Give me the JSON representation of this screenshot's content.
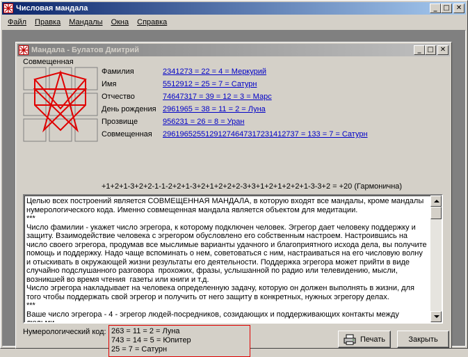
{
  "app": {
    "title": "Числовая мандала"
  },
  "menu": [
    {
      "label": "Файл"
    },
    {
      "label": "Правка"
    },
    {
      "label": "Мандалы"
    },
    {
      "label": "Окна"
    },
    {
      "label": "Справка"
    }
  ],
  "window": {
    "title": "Мандала - Булатов Дмитрий",
    "combined_heading": "Совмещенная"
  },
  "info_rows": [
    {
      "label": "Фамилия",
      "value": "2341273 = 22 = 4 = Меркурий"
    },
    {
      "label": "Имя",
      "value": "5512912 = 25 = 7 = Сатурн"
    },
    {
      "label": "Отчество",
      "value": "74647317 = 39 = 12 = 3 = Марс"
    },
    {
      "label": "День рождения",
      "value": "2961965 = 38 = 11 = 2 = Луна"
    },
    {
      "label": "Прозвище",
      "value": "956231 = 26 = 8 = Уран"
    },
    {
      "label": "Совмещенная",
      "value": "29619652551291274647317231412737 = 133 = 7 = Сатурн"
    }
  ],
  "harmony_line": "+1+2+1-3+2+2-1-1-2+2+1-3+2+1+2+2+2-3+3+1+2+1+2+2+1-3-3+2 = +20  (Гармонична)",
  "description": "Целью всех построений является СОВМЕЩЕННАЯ МАНДАЛА, в которую входят все мандалы, кроме мандалы нумерологического кода. Именно совмещенная мандала является объектом для медитации.\n***\nЧисло фамилии - укажет число эгрегора, к которому подключен человек. Эгрегор дает человеку поддержку и защиту. Взаимодействие человека с эгрегором обусловлено его собственным настроем. Настроившись на число своего эгрегора, продумав все мыслимые варианты удачного и благоприятного исхода дела, вы получите помощь и поддержку. Надо чаще вспоминать о нем, советоваться с ним, настраиваться на его числовую волну и отыскивать в окружающей жизни результаты его деятельности. Поддержка эгрегора может прийти в виде случайно подслушанного разговора  прохожих, фразы, услышанной по радио или телевидению, мысли, возникшей во время чтения  газеты или книги и т.д.\nЧисло эгрегора накладывает на человека определенную задачу, которую он должен выполнять в жизни, для того чтобы поддержать свой эгрегор и получить от него защиту в конкретных, нужных эгрегору делах.\n***\nВаше число эгрегора - 4 - эгрегор людей-посредников, созидающих и поддерживающих контакты между людьми.",
  "numerology": {
    "label": "Нумерологический код:",
    "lines": [
      "263 = 11 = 2 = Луна",
      "743 = 14 = 5 = Юпитер",
      "25 = 7 = Сатурн"
    ]
  },
  "buttons": {
    "print": "Печать",
    "close": "Закрыть"
  },
  "colors": {
    "accent_red": "#e00000",
    "link_blue": "#0000c8",
    "title_blue": "#0a246a"
  }
}
